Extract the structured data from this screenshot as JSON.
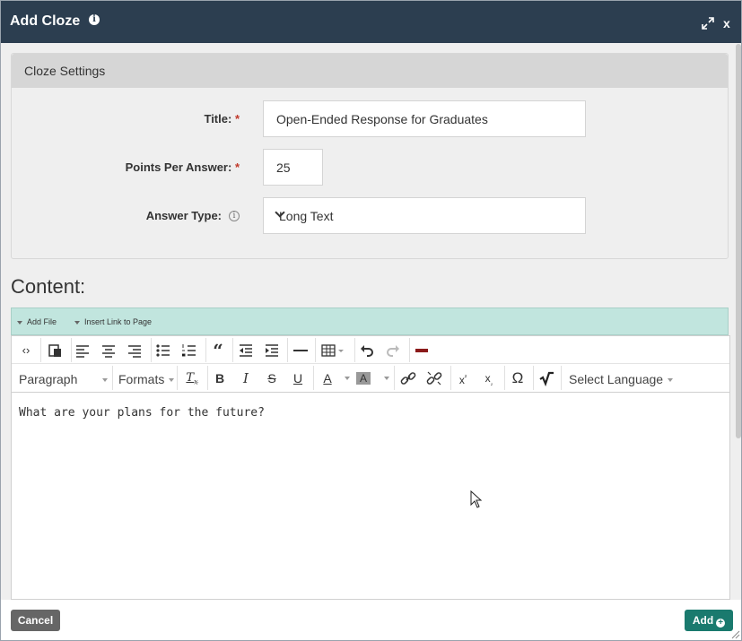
{
  "dialog": {
    "title": "Add Cloze",
    "close_label": "x"
  },
  "settings": {
    "heading": "Cloze Settings",
    "title_label": "Title:",
    "title_value": "Open-Ended Response for Graduates",
    "points_label": "Points Per Answer:",
    "points_value": "25",
    "answer_type_label": "Answer Type:",
    "answer_type_value": "Long Text",
    "required_mark": "*"
  },
  "content": {
    "heading": "Content:",
    "file_bar": {
      "add_file": "Add File",
      "insert_link": "Insert Link to Page"
    },
    "toolbar": {
      "paragraph": "Paragraph",
      "formats": "Formats",
      "select_language": "Select Language",
      "bold": "B",
      "italic": "I",
      "strike": "S",
      "underline": "U",
      "font_color": "A",
      "bg_color": "A",
      "omega": "Ω"
    },
    "body_text": "What are your plans for the future?"
  },
  "footer": {
    "cancel_label": "Cancel",
    "add_label": "Add"
  },
  "colors": {
    "titlebar": "#2c3e50",
    "file_bar": "#c1e5de",
    "add_button": "#1a7a6e",
    "cancel_button": "#666666",
    "required": "#c0392b"
  }
}
